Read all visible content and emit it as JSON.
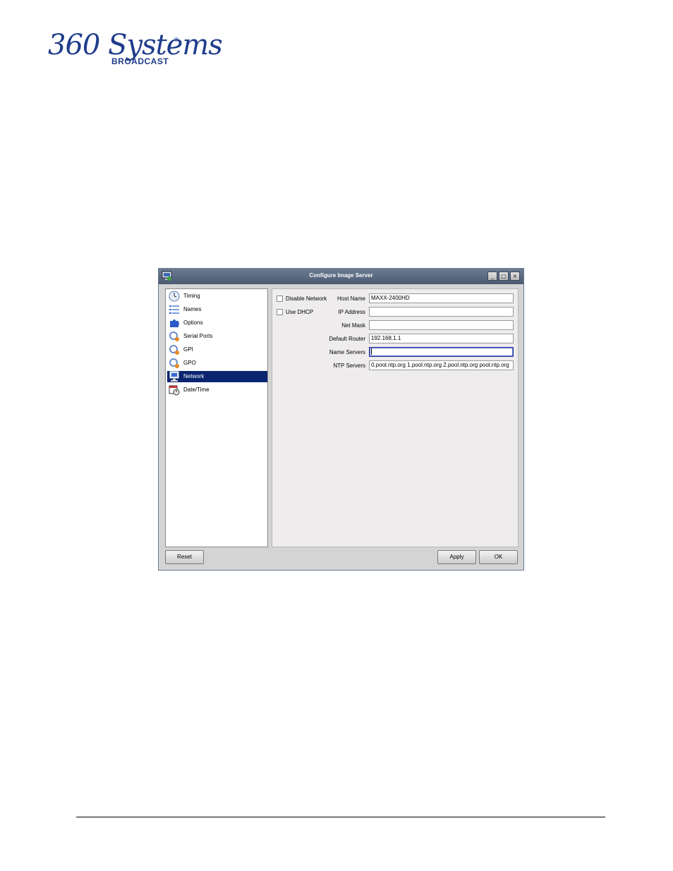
{
  "logo": {
    "script": "360 Systems",
    "registered": "®",
    "sub": "BROADCAST"
  },
  "window": {
    "title": "Configure Image Server",
    "controls": {
      "minimize": "_",
      "maximize": "□",
      "close": "×"
    }
  },
  "sidebar": {
    "items": [
      {
        "label": "Timing",
        "icon": "clock-icon"
      },
      {
        "label": "Names",
        "icon": "list-icon"
      },
      {
        "label": "Options",
        "icon": "puzzle-icon"
      },
      {
        "label": "Serial Ports",
        "icon": "port-icon"
      },
      {
        "label": "GPI",
        "icon": "port-icon"
      },
      {
        "label": "GPO",
        "icon": "port-icon"
      },
      {
        "label": "Network",
        "icon": "computer-icon",
        "selected": true
      },
      {
        "label": "Date/Time",
        "icon": "calendar-clock-icon"
      }
    ]
  },
  "network": {
    "disable_network": {
      "label": "Disable Network",
      "checked": false
    },
    "use_dhcp": {
      "label": "Use DHCP",
      "checked": false
    },
    "host_name": {
      "label": "Host Name",
      "value": "MAXX-2400HD"
    },
    "ip_address": {
      "label": "IP Address",
      "value": ""
    },
    "net_mask": {
      "label": "Net Mask",
      "value": ""
    },
    "default_router": {
      "label": "Default Router",
      "value": "192.168.1.1"
    },
    "name_servers": {
      "label": "Name Servers",
      "value": ""
    },
    "ntp_servers": {
      "label": "NTP Servers",
      "value": "0.pool.ntp.org  1.pool.ntp.org  2.pool.ntp.org  pool.ntp.org"
    }
  },
  "buttons": {
    "reset": "Reset",
    "apply": "Apply",
    "ok": "OK"
  },
  "colors": {
    "selection": "#0a2470",
    "titlebar": "#5a6a82",
    "brand": "#1f3c8c"
  }
}
